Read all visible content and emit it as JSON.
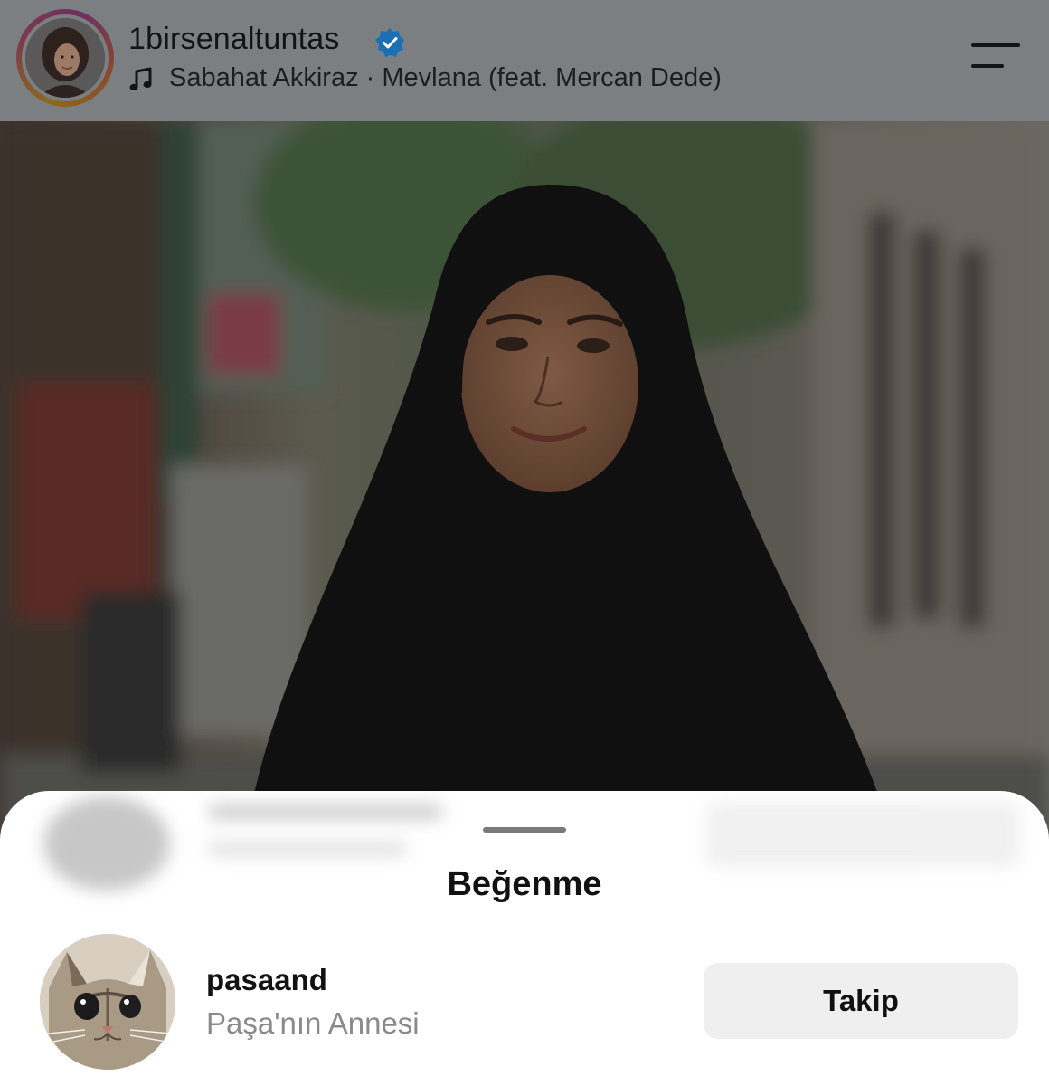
{
  "post_header": {
    "username": "1birsenaltuntas",
    "verified": true,
    "audio": "Sabahat Akkiraz · Mevlana (feat. Mercan Dede)"
  },
  "icons": {
    "verified": "verified-badge-icon",
    "music": "music-note-icon",
    "menu": "menu-icon"
  },
  "likes_sheet": {
    "title": "Beğenme",
    "likers": [
      {
        "username": "pasaand",
        "full_name": "Paşa'nın Annesi",
        "follow_label": "Takip"
      }
    ]
  },
  "colors": {
    "verified_blue": "#1b6fb5",
    "follow_button_bg": "#efefef",
    "secondary_text": "#8a8a8a"
  }
}
